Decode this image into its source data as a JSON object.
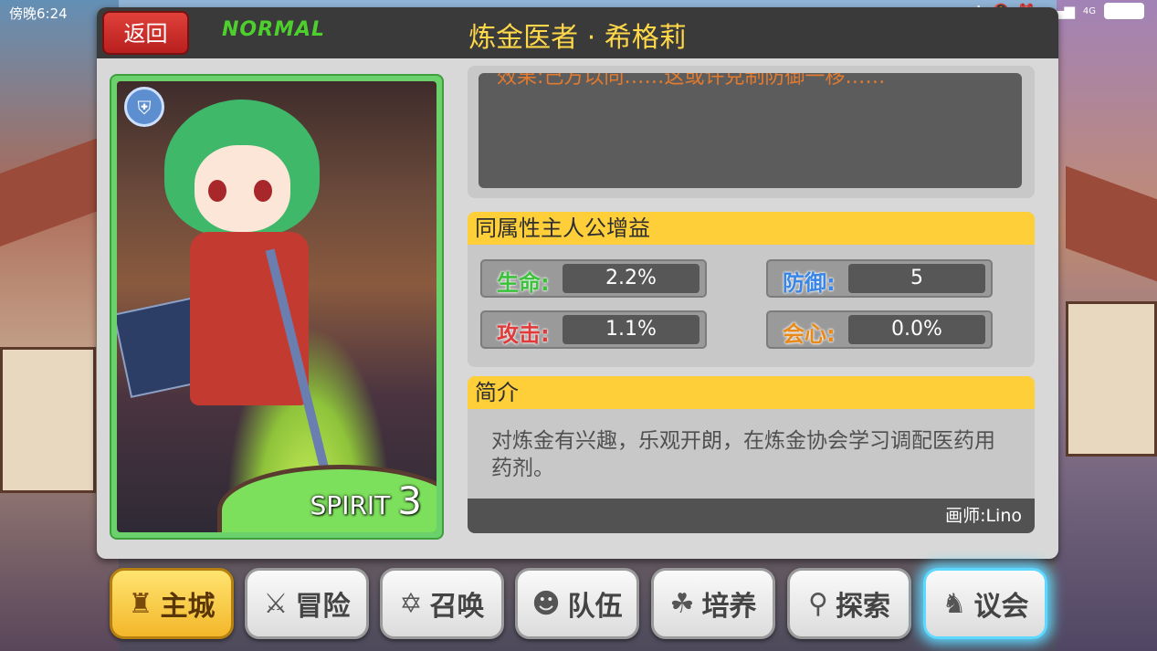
{
  "status_bar": {
    "time": "傍晚6:24",
    "indicators": [
      "...",
      "bluetooth-icon",
      "mute-icon",
      "alarm-icon",
      "signal-icon",
      "4G",
      "battery-icon"
    ]
  },
  "header": {
    "back_label": "返回",
    "mode_label": "NORMAL",
    "title": "炼金医者 · 希格莉"
  },
  "card": {
    "attribute_icon": "shield-icon",
    "type_label": "SPIRIT",
    "rank": "3"
  },
  "skill": {
    "text": "效果:己方以同……这或许克制防御一移……"
  },
  "bonus": {
    "heading": "同属性主人公增益",
    "stats": [
      {
        "key": "生命:",
        "value": "2.2%",
        "color": "#3bc23b"
      },
      {
        "key": "防御:",
        "value": "5",
        "color": "#3a86e6"
      },
      {
        "key": "攻击:",
        "value": "1.1%",
        "color": "#e03a3a"
      },
      {
        "key": "会心:",
        "value": "0.0%",
        "color": "#e88a1a"
      }
    ]
  },
  "intro": {
    "heading": "简介",
    "text": "对炼金有兴趣，乐观开朗，在炼金协会学习调配医药用药剂。",
    "artist": "画师:Lino"
  },
  "nav": {
    "items": [
      {
        "label": "主城",
        "icon": "castle-icon"
      },
      {
        "label": "冒险",
        "icon": "crossed-swords-icon"
      },
      {
        "label": "召唤",
        "icon": "hexagram-icon"
      },
      {
        "label": "队伍",
        "icon": "team-icon"
      },
      {
        "label": "培养",
        "icon": "training-icon"
      },
      {
        "label": "探索",
        "icon": "explore-icon"
      },
      {
        "label": "议会",
        "icon": "council-icon"
      }
    ]
  }
}
